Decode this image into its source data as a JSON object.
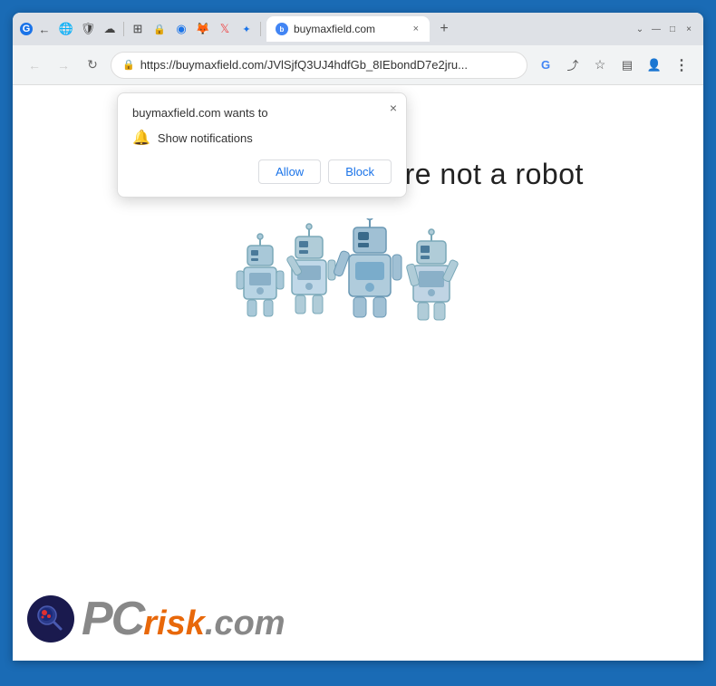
{
  "browser": {
    "title": "buymaxfield.com",
    "url": "https://buymaxfield.com/JVlSjfQ3UJ4hdfGb_8IEbondD7e2jru...",
    "url_display": "https://buymaxfield.com/JVlSjfQ3UJ4hdfGb_8IEbondD7e2jru...",
    "tab_label": "buymaxfield.com",
    "new_tab_label": "+"
  },
  "nav": {
    "back": "←",
    "forward": "→",
    "refresh": "↻"
  },
  "popup": {
    "title": "buymaxfield.com wants to",
    "close_icon": "×",
    "notification_text": "Show notifications",
    "allow_label": "Allow",
    "block_label": "Block"
  },
  "page": {
    "main_message": "Click \"Allow\"  if you are not  a robot"
  },
  "brand": {
    "pc_text": "PC",
    "risk_text": "risk",
    "com_text": ".com"
  },
  "icons": {
    "bell": "🔔",
    "lock": "🔒",
    "g_logo": "G",
    "share": "⎙",
    "star": "☆",
    "sidebar": "▤",
    "account": "👤",
    "menu": "⋮",
    "chrome_tab": "●",
    "extensions": "⬛",
    "minimize": "—",
    "maximize": "□",
    "close_win": "×",
    "chevron_down": "⌄"
  },
  "toolbar_extensions": [
    "⊞",
    "🔒",
    "🌩",
    "🎭",
    "🔵",
    "💻",
    "✕"
  ]
}
